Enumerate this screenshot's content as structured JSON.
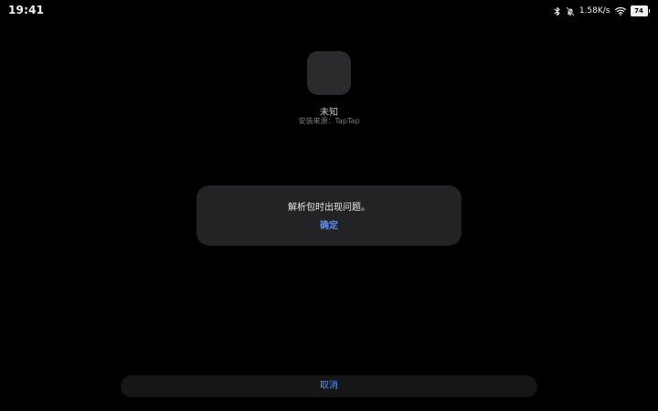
{
  "status_bar": {
    "time": "19:41",
    "net_speed": "1.58K/s",
    "battery": "74",
    "icons": [
      "bluetooth-icon",
      "mute-icon",
      "wifi-icon",
      "battery-icon"
    ]
  },
  "app": {
    "name": "未知",
    "source": "安装来源：TapTap"
  },
  "dialog": {
    "message": "解析包时出现问题。",
    "confirm_label": "确定"
  },
  "footer": {
    "cancel_label": "取消"
  },
  "colors": {
    "background": "#000000",
    "dialog": "#232325",
    "accent": "#5b8ff0"
  }
}
